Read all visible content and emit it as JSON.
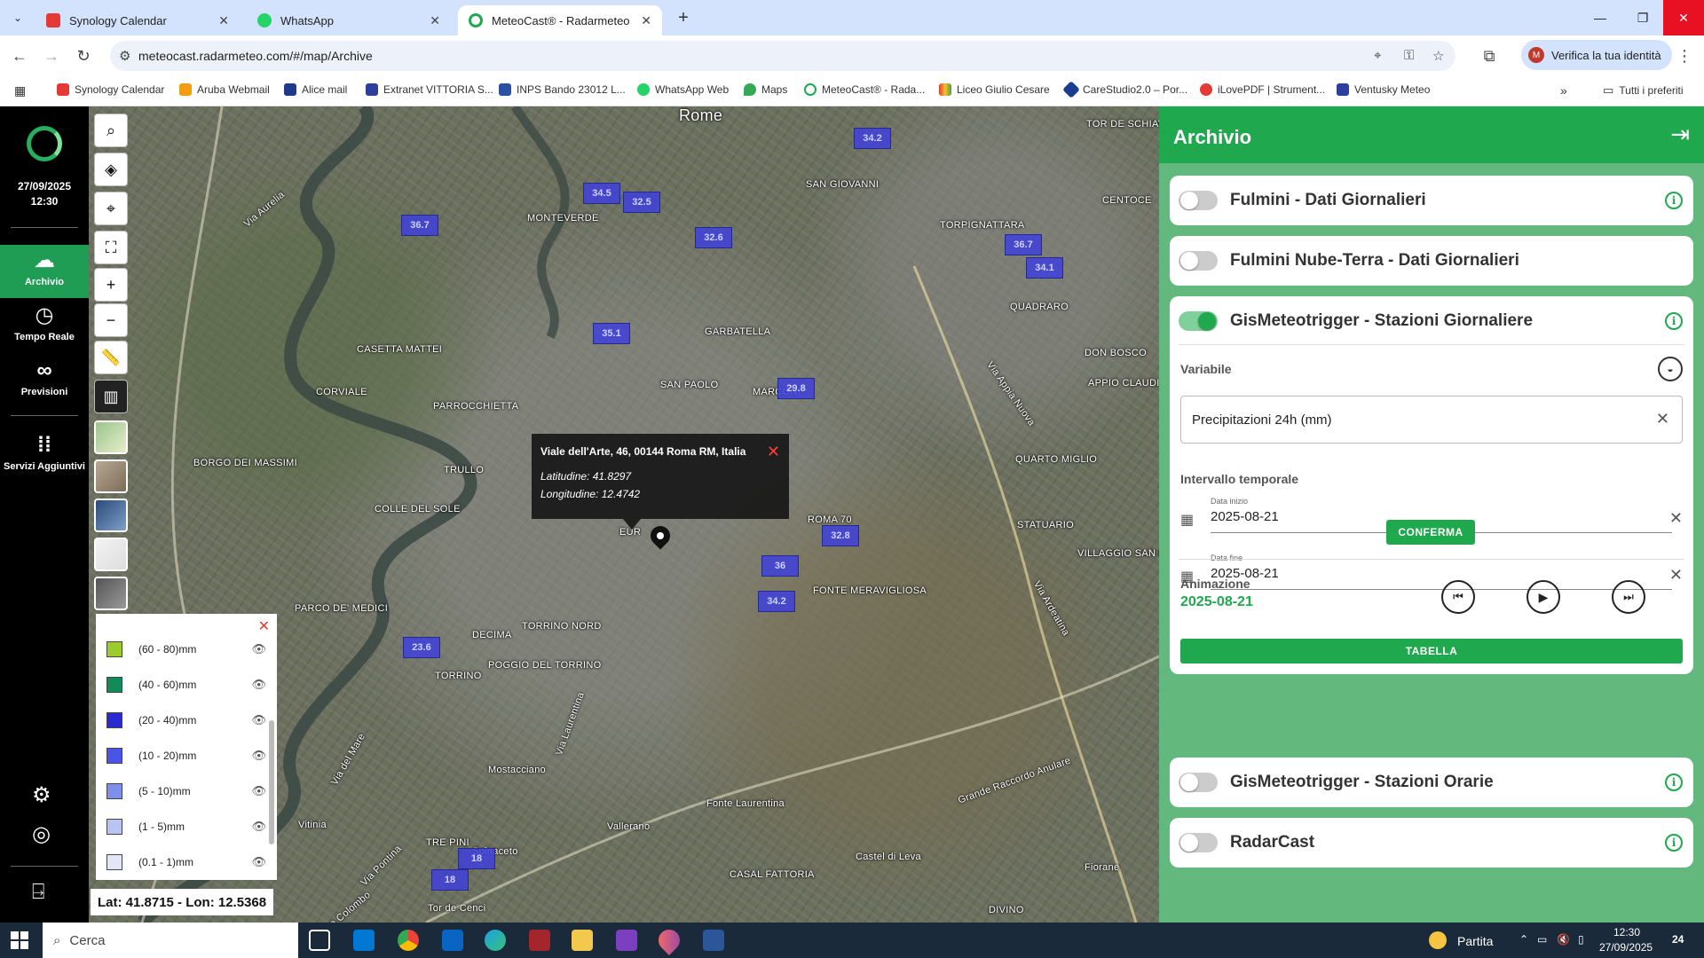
{
  "browser": {
    "tabs": [
      {
        "title": "Synology Calendar",
        "color": "#e53935"
      },
      {
        "title": "WhatsApp",
        "color": "#25d366"
      },
      {
        "title": "MeteoCast® - Radarmeteo",
        "color": "#1fa84e"
      }
    ],
    "url": "meteocast.radarmeteo.com/#/map/Archive",
    "verify_label": "Verifica la tua identità",
    "bookmarks": [
      "Synology Calendar",
      "Aruba Webmail",
      "Alice mail",
      "Extranet VITTORIA S...",
      "INPS Bando 23012 L...",
      "WhatsApp Web",
      "Maps",
      "MeteoCast® - Rada...",
      "Liceo Giulio Cesare",
      "CareStudio2.0 – Por...",
      "iLovePDF | Strument...",
      "Ventusky Meteo"
    ],
    "all_bookmarks": "Tutti i preferiti"
  },
  "nav": {
    "date": "27/09/2025",
    "time": "12:30",
    "items": [
      {
        "label": "Archivio",
        "icon": "archive-icon"
      },
      {
        "label": "Tempo Reale",
        "icon": "clock-icon"
      },
      {
        "label": "Previsioni",
        "icon": "binoculars-icon"
      },
      {
        "label": "Servizi Aggiuntivi",
        "icon": "grid-dots-icon"
      }
    ]
  },
  "map": {
    "places": [
      "Rome",
      "MONTEVERDE",
      "SAN GIOVANNI",
      "TORPIGNATTARA",
      "CENTOCE",
      "TOR DE SCHIAVI",
      "GARBATELLA",
      "QUADRARO",
      "CASETTA MATTEI",
      "SAN PAOLO",
      "MARCONI",
      "DON BOSCO",
      "APPIO CLAUDIO",
      "CORVIALE",
      "PARROCCHIETTA",
      "QUARTO MIGLIO",
      "BORGO DEI MASSIMI",
      "TRULLO",
      "COLLE DEL SOLE",
      "EUR",
      "ROMA 70",
      "STATUARIO",
      "VILLAGGIO SAN BARBARA",
      "PARCO DE' MEDICI",
      "FONTE MERAVIGLIOSA",
      "DECIMA",
      "TORRINO NORD",
      "TORRINO",
      "POGGIO DEL TORRINO",
      "Mostacciano",
      "Vallerano",
      "Fonte Laurentina",
      "Vitinia",
      "TRE PINI",
      "Spinaceto",
      "CASAL FATTORIA",
      "Castel di Leva",
      "Fiorane",
      "DIVINO",
      "Tor de Cenci",
      "Via Appia Nuova",
      "Grande Raccordo Anulare",
      "Via Aurelia",
      "Via Cristoforo Colombo",
      "Via Laurentina",
      "Via Ardeatina",
      "Via Pontina",
      "Via del Mare"
    ],
    "stations": [
      "36.7",
      "34.5",
      "32.5",
      "34.2",
      "32.6",
      "36.7",
      "34.1",
      "35.1",
      "29.8",
      "32.8",
      "36",
      "34.2",
      "23.6",
      "18",
      "18"
    ],
    "popup": {
      "address": "Viale dell'Arte, 46, 00144 Roma RM, Italia",
      "lat": "Latitudine: 41.8297",
      "lon": "Longitudine: 12.4742"
    },
    "legend": [
      {
        "label": "(60 - 80)mm",
        "color": "#9ccc2c"
      },
      {
        "label": "(40 - 60)mm",
        "color": "#128a5a"
      },
      {
        "label": "(20 - 40)mm",
        "color": "#2a2ad0"
      },
      {
        "label": "(10 - 20)mm",
        "color": "#4a55e8"
      },
      {
        "label": "(5 - 10)mm",
        "color": "#7f90ec"
      },
      {
        "label": "(1 - 5)mm",
        "color": "#b8c4f2"
      },
      {
        "label": "(0.1 - 1)mm",
        "color": "#e3e7f5"
      }
    ],
    "coords": "Lat: 41.8715 - Lon: 12.5368"
  },
  "panel": {
    "title": "Archivio",
    "cards": {
      "fulmini": "Fulmini - Dati Giornalieri",
      "nube_terra": "Fulmini Nube-Terra - Dati Giornalieri",
      "gis_giornaliere": "GisMeteotrigger - Stazioni Giornaliere",
      "gis_orarie": "GisMeteotrigger - Stazioni Orarie",
      "radarcast": "RadarCast"
    },
    "variable_label": "Variabile",
    "variable_value": "Precipitazioni 24h (mm)",
    "interval_label": "Intervallo temporale",
    "start_caption": "Data inizio",
    "start_value": "2025-08-21",
    "end_caption": "Data fine",
    "end_value": "2025-08-21",
    "confirm_label": "CONFERMA",
    "animation_label": "Animazione",
    "animation_date": "2025-08-21",
    "table_label": "TABELLA"
  },
  "taskbar": {
    "search_placeholder": "Cerca",
    "weather": "Partita",
    "time": "12:30",
    "date": "27/09/2025",
    "notifications": "24"
  }
}
